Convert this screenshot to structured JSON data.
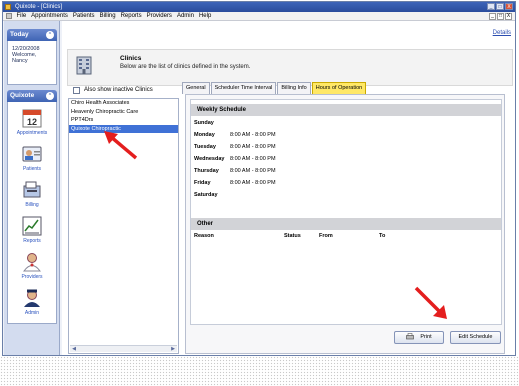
{
  "window": {
    "title": "Quixote - [Clinics]",
    "win_buttons": [
      "_",
      "□",
      "X"
    ]
  },
  "menu": {
    "items": [
      "File",
      "Appointments",
      "Patients",
      "Billing",
      "Reports",
      "Providers",
      "Admin",
      "Help"
    ],
    "mdi_buttons": [
      "_",
      "□",
      "X"
    ]
  },
  "today": {
    "header": "Today",
    "date": "12/20/2008",
    "welcome": "Welcome,",
    "user": "Nancy"
  },
  "quixote": {
    "header": "Quixote",
    "chevron": "⌃",
    "items": [
      "Appointments",
      "Patients",
      "Billing",
      "Reports",
      "Providers",
      "Admin"
    ]
  },
  "details_link": "Details",
  "page": {
    "title": "Clinics",
    "description": "Below are the list of clinics defined in the system."
  },
  "show_inactive_label": "Also show inactive Clinics",
  "clinics": [
    "Chiro Health Associates",
    "Heavenly Chiropractic Care",
    "PPT4Drs",
    "Quixote Chiropractic"
  ],
  "selected_clinic_index": 3,
  "tabs": [
    "General",
    "Scheduler Time Interval",
    "Billing Info",
    "Hours of Operation"
  ],
  "active_tab": "Hours of Operation",
  "weekly_schedule": {
    "header": "Weekly Schedule",
    "days": [
      {
        "day": "Sunday",
        "hours": ""
      },
      {
        "day": "Monday",
        "hours": "8:00 AM - 8:00 PM"
      },
      {
        "day": "Tuesday",
        "hours": "8:00 AM - 8:00 PM"
      },
      {
        "day": "Wednesday",
        "hours": "8:00 AM - 8:00 PM"
      },
      {
        "day": "Thursday",
        "hours": "8:00 AM - 8:00 PM"
      },
      {
        "day": "Friday",
        "hours": "8:00 AM - 8:00 PM"
      },
      {
        "day": "Saturday",
        "hours": ""
      }
    ]
  },
  "other": {
    "header": "Other",
    "columns": [
      "Reason",
      "Status",
      "From",
      "To"
    ]
  },
  "buttons": {
    "print": "Print",
    "edit_schedule": "Edit Schedule"
  },
  "colors": {
    "accent": "#3f64b4",
    "selection": "#3f71d6",
    "active_tab": "#ffe866",
    "arrow": "#e41e1e"
  }
}
